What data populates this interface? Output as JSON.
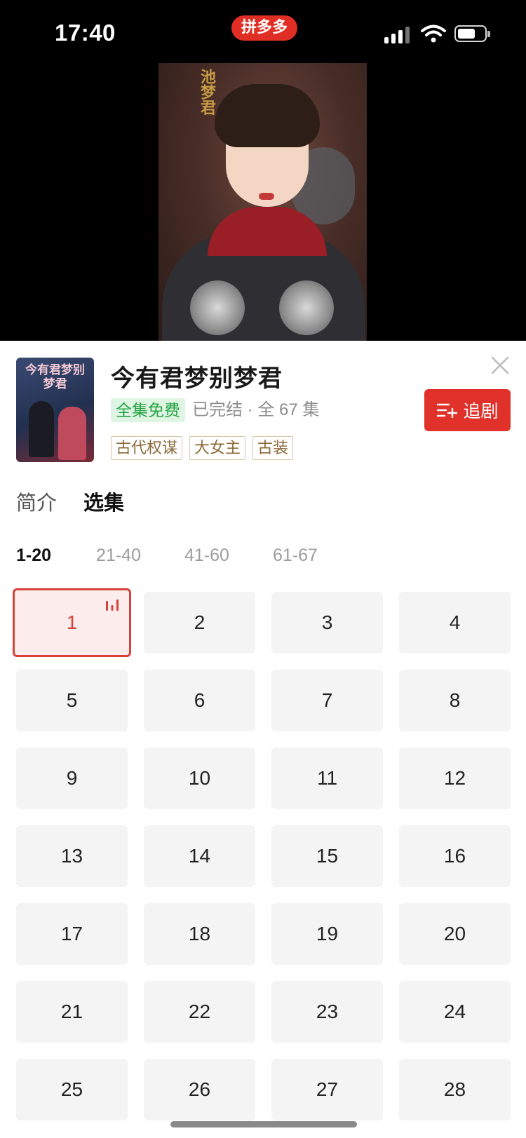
{
  "status_bar": {
    "time": "17:40",
    "app_badge": "拼多多"
  },
  "video": {
    "poster_calligraphy": "池梦君"
  },
  "drama": {
    "cover_text": "今有君梦别梦君",
    "title": "今有君梦别梦君",
    "free_badge": "全集免费",
    "status": "已完结 · 全 67 集",
    "tags": [
      "古代权谋",
      "大女主",
      "古装"
    ],
    "follow_label": "追剧"
  },
  "tabs": [
    {
      "label": "简介",
      "active": false
    },
    {
      "label": "选集",
      "active": true
    }
  ],
  "ranges": [
    {
      "label": "1-20",
      "active": true
    },
    {
      "label": "21-40",
      "active": false
    },
    {
      "label": "41-60",
      "active": false
    },
    {
      "label": "61-67",
      "active": false
    }
  ],
  "episodes": [
    "1",
    "2",
    "3",
    "4",
    "5",
    "6",
    "7",
    "8",
    "9",
    "10",
    "11",
    "12",
    "13",
    "14",
    "15",
    "16",
    "17",
    "18",
    "19",
    "20",
    "21",
    "22",
    "23",
    "24",
    "25",
    "26",
    "27",
    "28"
  ],
  "current_episode": "1",
  "colors": {
    "accent": "#e0322a",
    "free_green": "#27a344",
    "tag_brown": "#8b6a3a"
  }
}
